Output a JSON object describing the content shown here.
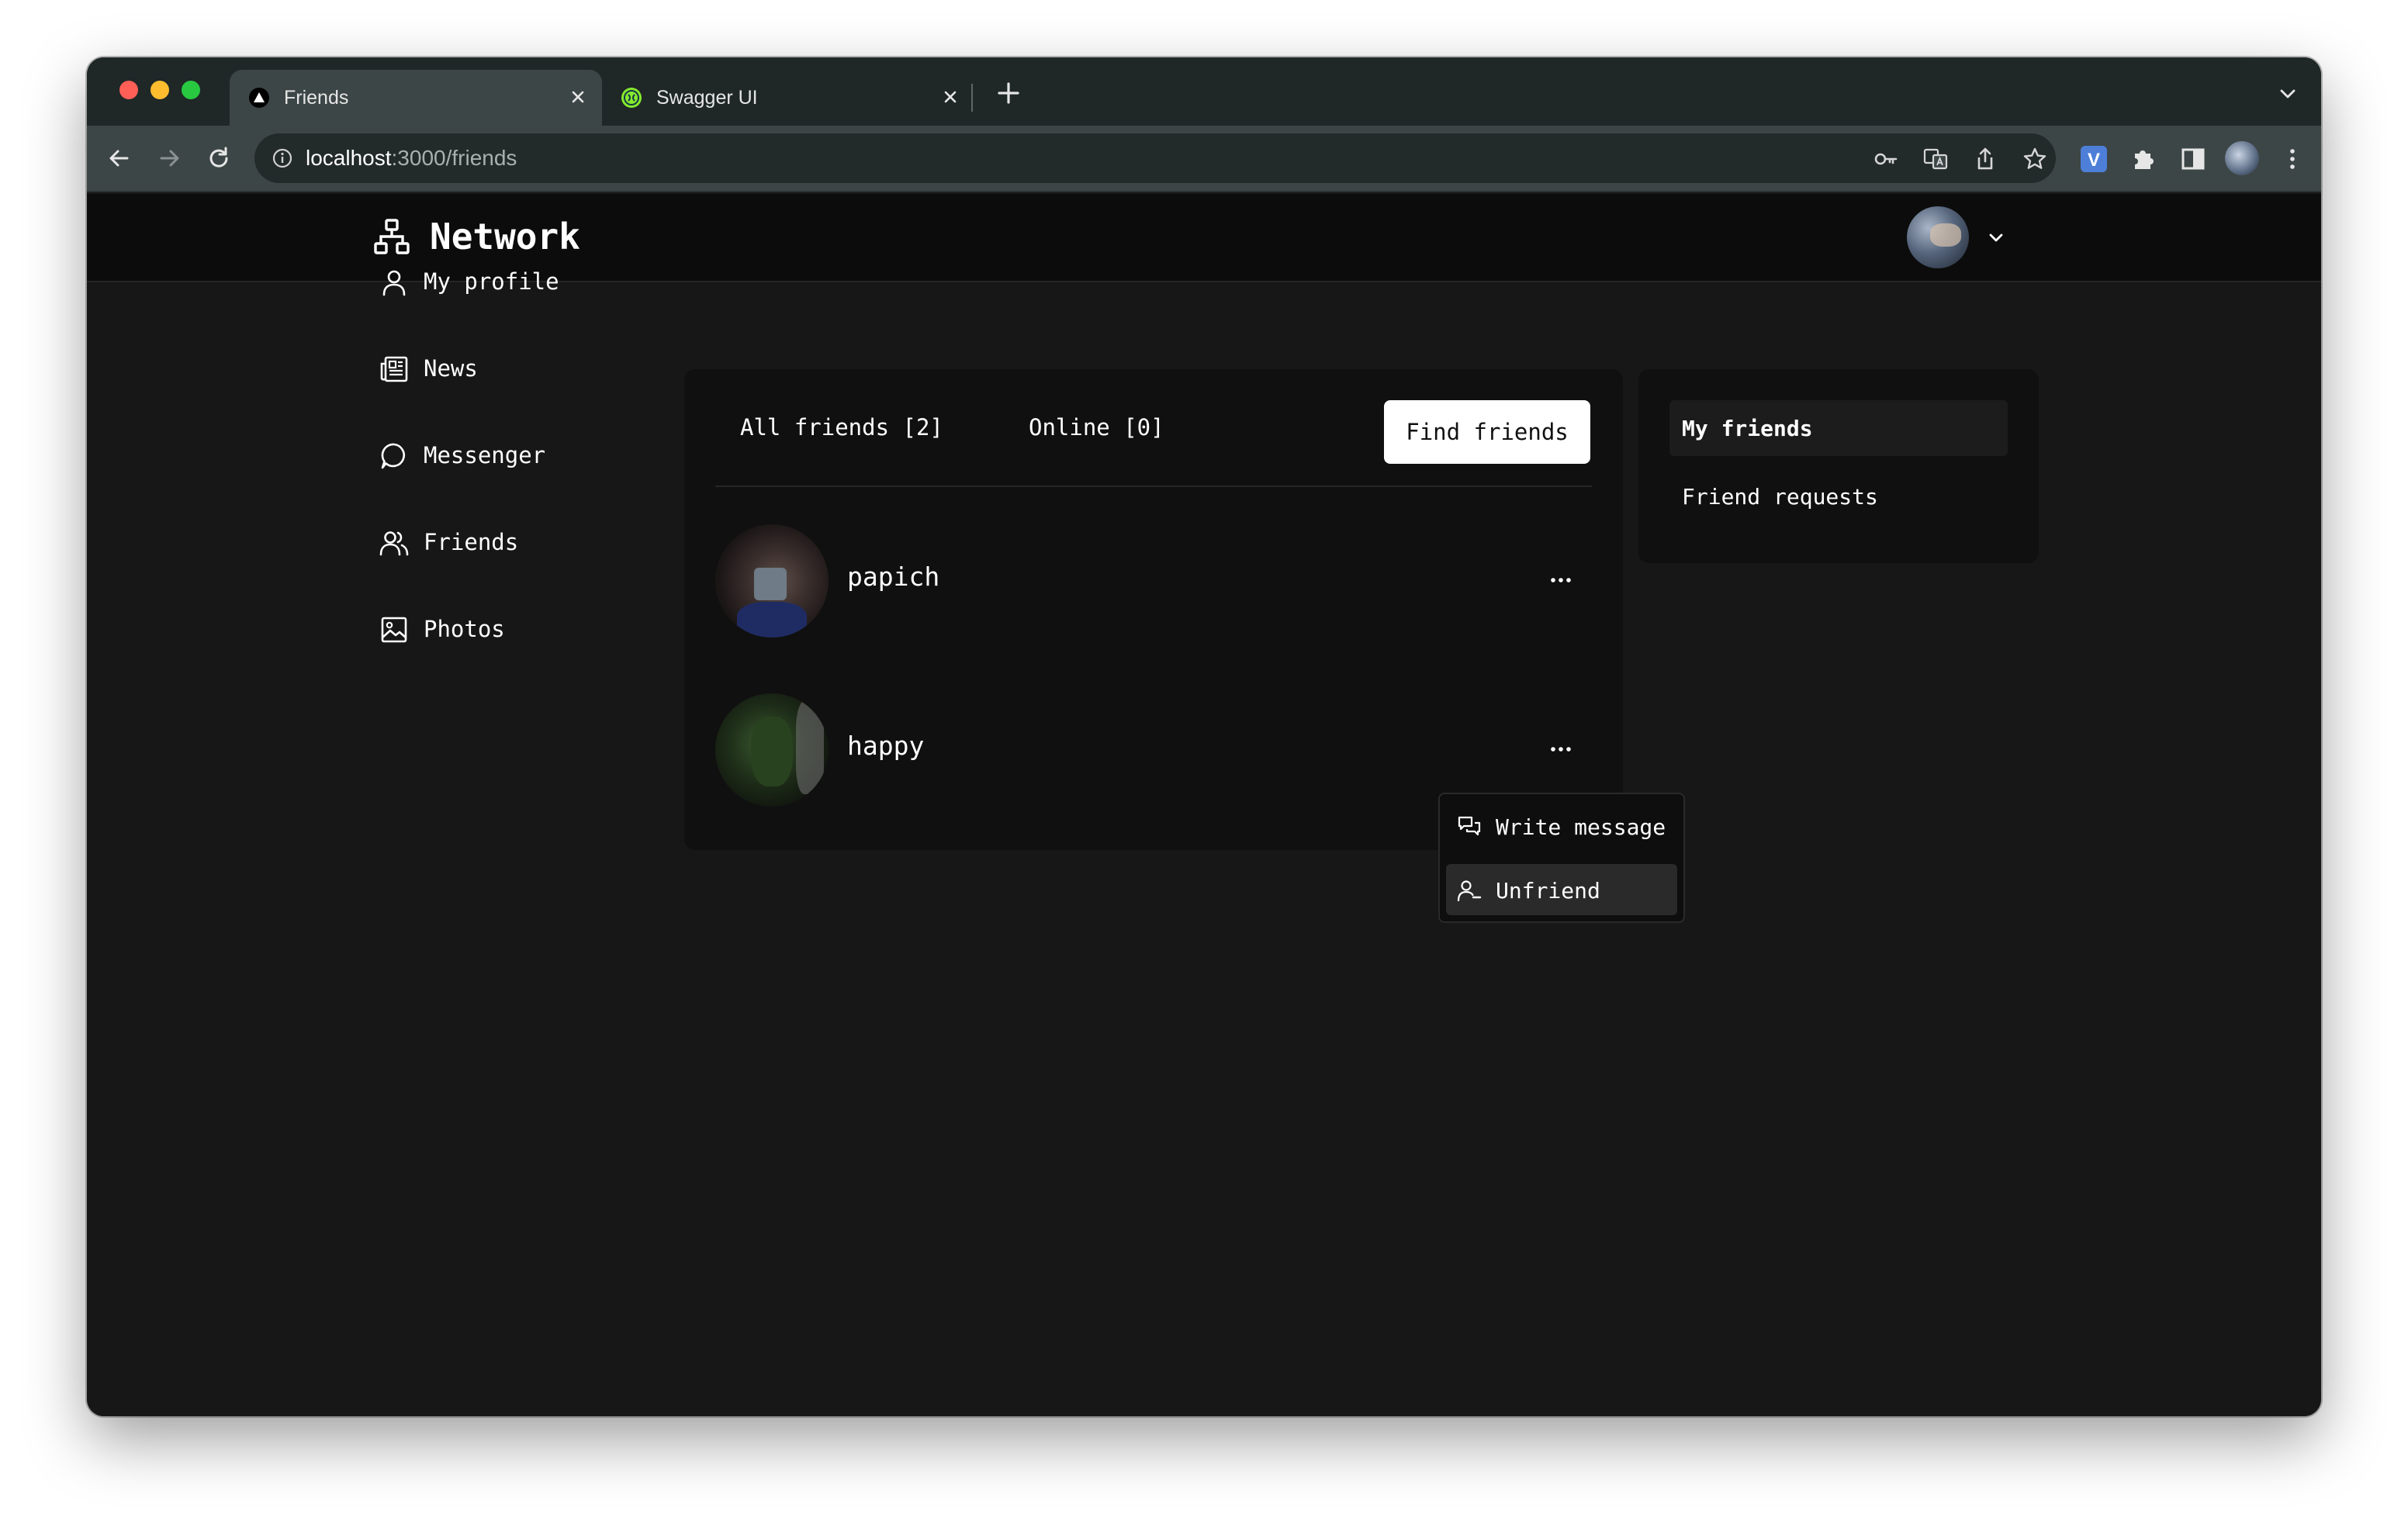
{
  "browser": {
    "tabs": [
      {
        "title": "Friends",
        "favicon": "triangle-logo-icon",
        "active": true
      },
      {
        "title": "Swagger UI",
        "favicon": "swagger-icon",
        "active": false
      }
    ],
    "url_host": "localhost",
    "url_path": ":3000/friends"
  },
  "app": {
    "brand": "Network"
  },
  "sidebar": {
    "items": [
      {
        "label": "My profile",
        "icon": "user-icon"
      },
      {
        "label": "News",
        "icon": "newspaper-icon"
      },
      {
        "label": "Messenger",
        "icon": "chat-bubble-icon"
      },
      {
        "label": "Friends",
        "icon": "users-icon"
      },
      {
        "label": "Photos",
        "icon": "image-icon"
      }
    ]
  },
  "friends_panel": {
    "tab_all": "All friends [2]",
    "tab_online": "Online [0]",
    "find_button": "Find friends",
    "friends": [
      {
        "name": "papich"
      },
      {
        "name": "happy"
      }
    ]
  },
  "menu": {
    "items": [
      {
        "label": "Write message",
        "icon": "chat-bubbles-icon"
      },
      {
        "label": "Unfriend",
        "icon": "user-minus-icon"
      }
    ]
  },
  "side_panel": {
    "items": [
      {
        "label": "My friends",
        "active": true
      },
      {
        "label": "Friend requests",
        "active": false
      }
    ]
  },
  "colors": {
    "page_bg": "#171717",
    "header_bg": "#0c0c0c",
    "card_bg": "#101010",
    "accent_button_bg": "#ffffff"
  }
}
